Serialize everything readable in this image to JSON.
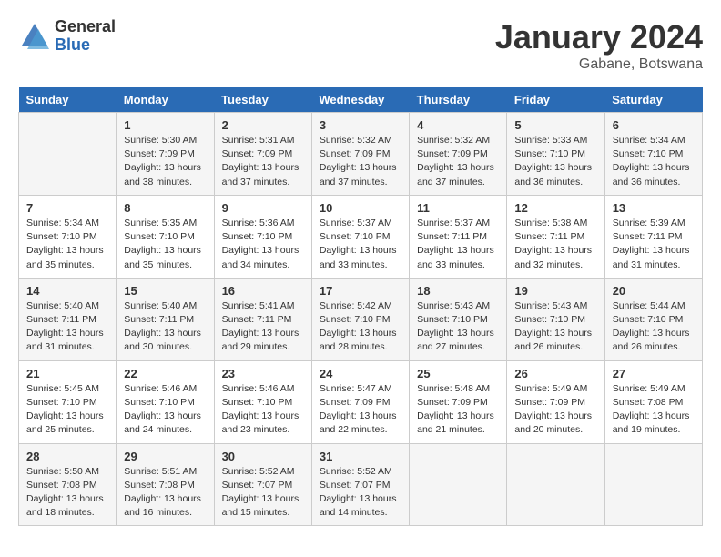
{
  "logo": {
    "general": "General",
    "blue": "Blue"
  },
  "title": "January 2024",
  "subtitle": "Gabane, Botswana",
  "weekdays": [
    "Sunday",
    "Monday",
    "Tuesday",
    "Wednesday",
    "Thursday",
    "Friday",
    "Saturday"
  ],
  "weeks": [
    [
      {
        "day": "",
        "sunrise": "",
        "sunset": "",
        "daylight": ""
      },
      {
        "day": "1",
        "sunrise": "Sunrise: 5:30 AM",
        "sunset": "Sunset: 7:09 PM",
        "daylight": "Daylight: 13 hours and 38 minutes."
      },
      {
        "day": "2",
        "sunrise": "Sunrise: 5:31 AM",
        "sunset": "Sunset: 7:09 PM",
        "daylight": "Daylight: 13 hours and 37 minutes."
      },
      {
        "day": "3",
        "sunrise": "Sunrise: 5:32 AM",
        "sunset": "Sunset: 7:09 PM",
        "daylight": "Daylight: 13 hours and 37 minutes."
      },
      {
        "day": "4",
        "sunrise": "Sunrise: 5:32 AM",
        "sunset": "Sunset: 7:09 PM",
        "daylight": "Daylight: 13 hours and 37 minutes."
      },
      {
        "day": "5",
        "sunrise": "Sunrise: 5:33 AM",
        "sunset": "Sunset: 7:10 PM",
        "daylight": "Daylight: 13 hours and 36 minutes."
      },
      {
        "day": "6",
        "sunrise": "Sunrise: 5:34 AM",
        "sunset": "Sunset: 7:10 PM",
        "daylight": "Daylight: 13 hours and 36 minutes."
      }
    ],
    [
      {
        "day": "7",
        "sunrise": "Sunrise: 5:34 AM",
        "sunset": "Sunset: 7:10 PM",
        "daylight": "Daylight: 13 hours and 35 minutes."
      },
      {
        "day": "8",
        "sunrise": "Sunrise: 5:35 AM",
        "sunset": "Sunset: 7:10 PM",
        "daylight": "Daylight: 13 hours and 35 minutes."
      },
      {
        "day": "9",
        "sunrise": "Sunrise: 5:36 AM",
        "sunset": "Sunset: 7:10 PM",
        "daylight": "Daylight: 13 hours and 34 minutes."
      },
      {
        "day": "10",
        "sunrise": "Sunrise: 5:37 AM",
        "sunset": "Sunset: 7:10 PM",
        "daylight": "Daylight: 13 hours and 33 minutes."
      },
      {
        "day": "11",
        "sunrise": "Sunrise: 5:37 AM",
        "sunset": "Sunset: 7:11 PM",
        "daylight": "Daylight: 13 hours and 33 minutes."
      },
      {
        "day": "12",
        "sunrise": "Sunrise: 5:38 AM",
        "sunset": "Sunset: 7:11 PM",
        "daylight": "Daylight: 13 hours and 32 minutes."
      },
      {
        "day": "13",
        "sunrise": "Sunrise: 5:39 AM",
        "sunset": "Sunset: 7:11 PM",
        "daylight": "Daylight: 13 hours and 31 minutes."
      }
    ],
    [
      {
        "day": "14",
        "sunrise": "Sunrise: 5:40 AM",
        "sunset": "Sunset: 7:11 PM",
        "daylight": "Daylight: 13 hours and 31 minutes."
      },
      {
        "day": "15",
        "sunrise": "Sunrise: 5:40 AM",
        "sunset": "Sunset: 7:11 PM",
        "daylight": "Daylight: 13 hours and 30 minutes."
      },
      {
        "day": "16",
        "sunrise": "Sunrise: 5:41 AM",
        "sunset": "Sunset: 7:11 PM",
        "daylight": "Daylight: 13 hours and 29 minutes."
      },
      {
        "day": "17",
        "sunrise": "Sunrise: 5:42 AM",
        "sunset": "Sunset: 7:10 PM",
        "daylight": "Daylight: 13 hours and 28 minutes."
      },
      {
        "day": "18",
        "sunrise": "Sunrise: 5:43 AM",
        "sunset": "Sunset: 7:10 PM",
        "daylight": "Daylight: 13 hours and 27 minutes."
      },
      {
        "day": "19",
        "sunrise": "Sunrise: 5:43 AM",
        "sunset": "Sunset: 7:10 PM",
        "daylight": "Daylight: 13 hours and 26 minutes."
      },
      {
        "day": "20",
        "sunrise": "Sunrise: 5:44 AM",
        "sunset": "Sunset: 7:10 PM",
        "daylight": "Daylight: 13 hours and 26 minutes."
      }
    ],
    [
      {
        "day": "21",
        "sunrise": "Sunrise: 5:45 AM",
        "sunset": "Sunset: 7:10 PM",
        "daylight": "Daylight: 13 hours and 25 minutes."
      },
      {
        "day": "22",
        "sunrise": "Sunrise: 5:46 AM",
        "sunset": "Sunset: 7:10 PM",
        "daylight": "Daylight: 13 hours and 24 minutes."
      },
      {
        "day": "23",
        "sunrise": "Sunrise: 5:46 AM",
        "sunset": "Sunset: 7:10 PM",
        "daylight": "Daylight: 13 hours and 23 minutes."
      },
      {
        "day": "24",
        "sunrise": "Sunrise: 5:47 AM",
        "sunset": "Sunset: 7:09 PM",
        "daylight": "Daylight: 13 hours and 22 minutes."
      },
      {
        "day": "25",
        "sunrise": "Sunrise: 5:48 AM",
        "sunset": "Sunset: 7:09 PM",
        "daylight": "Daylight: 13 hours and 21 minutes."
      },
      {
        "day": "26",
        "sunrise": "Sunrise: 5:49 AM",
        "sunset": "Sunset: 7:09 PM",
        "daylight": "Daylight: 13 hours and 20 minutes."
      },
      {
        "day": "27",
        "sunrise": "Sunrise: 5:49 AM",
        "sunset": "Sunset: 7:08 PM",
        "daylight": "Daylight: 13 hours and 19 minutes."
      }
    ],
    [
      {
        "day": "28",
        "sunrise": "Sunrise: 5:50 AM",
        "sunset": "Sunset: 7:08 PM",
        "daylight": "Daylight: 13 hours and 18 minutes."
      },
      {
        "day": "29",
        "sunrise": "Sunrise: 5:51 AM",
        "sunset": "Sunset: 7:08 PM",
        "daylight": "Daylight: 13 hours and 16 minutes."
      },
      {
        "day": "30",
        "sunrise": "Sunrise: 5:52 AM",
        "sunset": "Sunset: 7:07 PM",
        "daylight": "Daylight: 13 hours and 15 minutes."
      },
      {
        "day": "31",
        "sunrise": "Sunrise: 5:52 AM",
        "sunset": "Sunset: 7:07 PM",
        "daylight": "Daylight: 13 hours and 14 minutes."
      },
      {
        "day": "",
        "sunrise": "",
        "sunset": "",
        "daylight": ""
      },
      {
        "day": "",
        "sunrise": "",
        "sunset": "",
        "daylight": ""
      },
      {
        "day": "",
        "sunrise": "",
        "sunset": "",
        "daylight": ""
      }
    ]
  ]
}
